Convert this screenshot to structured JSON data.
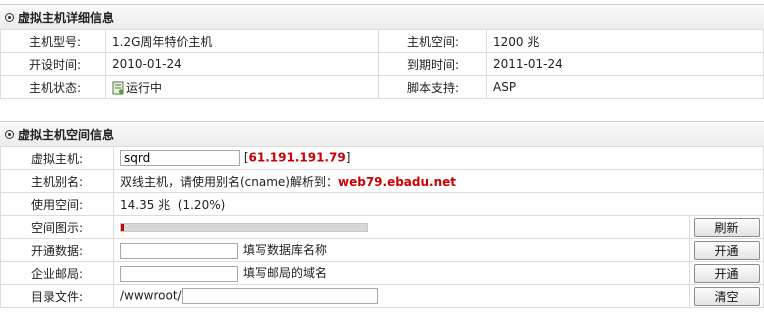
{
  "detail_section": {
    "title": "虚拟主机详细信息",
    "model_label": "主机型号:",
    "model_value": "1.2G周年特价主机",
    "space_label": "主机空间:",
    "space_value": "1200 兆",
    "open_label": "开设时间:",
    "open_value": "2010-01-24",
    "expire_label": "到期时间:",
    "expire_value": "2011-01-24",
    "status_label": "主机状态:",
    "status_value": "运行中",
    "script_label": "脚本支持:",
    "script_value": "ASP"
  },
  "space_section": {
    "title": "虚拟主机空间信息",
    "host_label": "虚拟主机:",
    "host_value": "sqrd",
    "ip_open": "[",
    "ip_value": "61.191.191.79",
    "ip_close": "]",
    "alias_label": "主机别名:",
    "alias_text": "双线主机，请使用别名(cname)解析到：",
    "alias_domain": "web79.ebadu.net",
    "used_label": "使用空间:",
    "used_value": "14.35 兆  (1.20%)",
    "usage_percent": 1.2,
    "chart_label": "空间图示:",
    "refresh_button": "刷新",
    "db_label": "开通数据:",
    "db_value": "",
    "db_hint": "填写数据库名称",
    "db_button": "开通",
    "mail_label": "企业邮局:",
    "mail_value": "",
    "mail_hint": "填写邮局的域名",
    "mail_button": "开通",
    "dir_label": "目录文件:",
    "dir_prefix": "/wwwroot/",
    "dir_value": "",
    "clear_button": "清空"
  }
}
